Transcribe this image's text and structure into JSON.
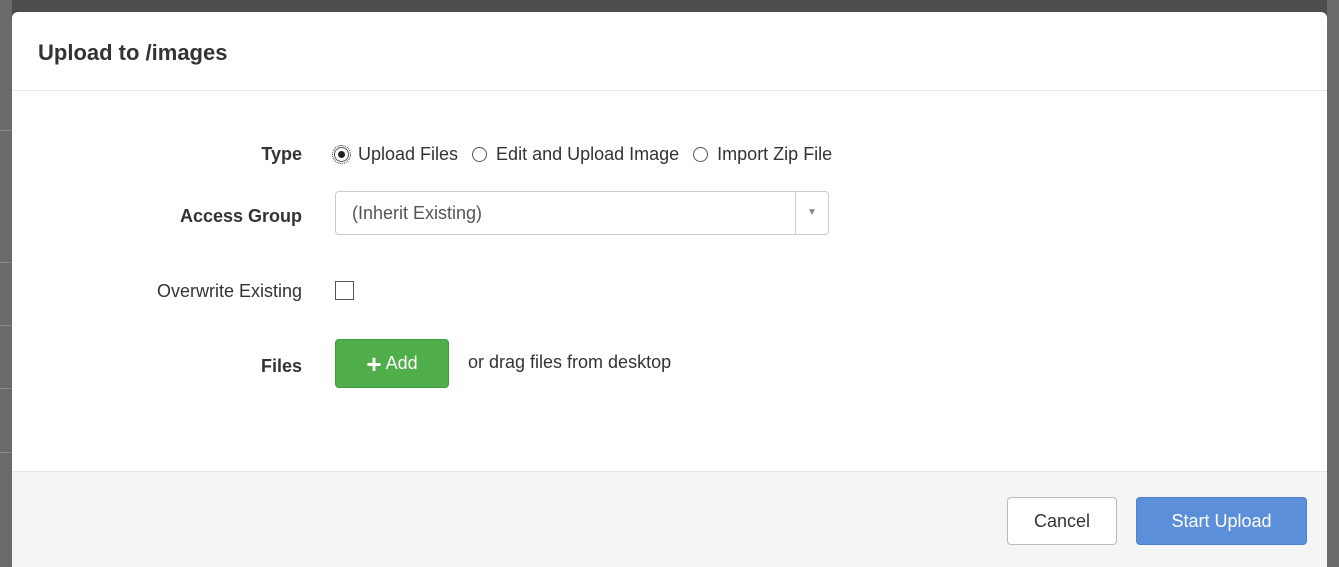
{
  "modal": {
    "title": "Upload to /images"
  },
  "form": {
    "type": {
      "label": "Type",
      "options": [
        {
          "label": "Upload Files",
          "checked": true
        },
        {
          "label": "Edit and Upload Image",
          "checked": false
        },
        {
          "label": "Import Zip File",
          "checked": false
        }
      ]
    },
    "access_group": {
      "label": "Access Group",
      "selected": "(Inherit Existing)"
    },
    "overwrite": {
      "label": "Overwrite Existing",
      "checked": false
    },
    "files": {
      "label": "Files",
      "add_label": "Add",
      "hint": "or drag files from desktop"
    }
  },
  "footer": {
    "cancel_label": "Cancel",
    "submit_label": "Start Upload"
  },
  "colors": {
    "add_button": "#4fae4a",
    "primary_button": "#5b8fd9"
  }
}
